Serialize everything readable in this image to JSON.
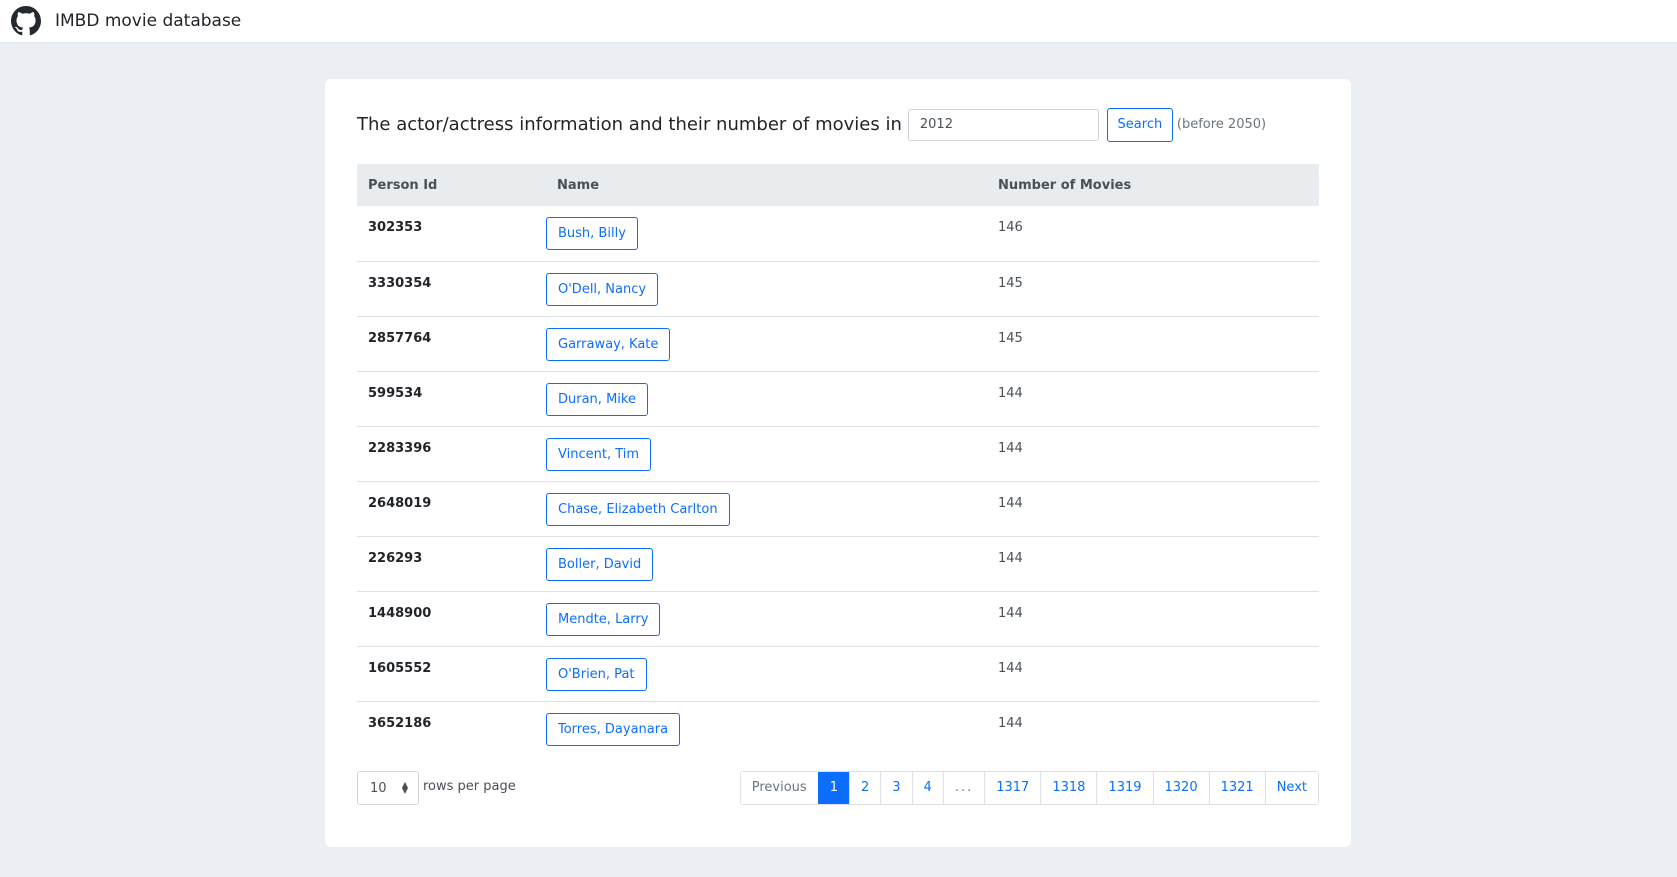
{
  "navbar": {
    "icon": "github-icon",
    "brand": "IMBD movie database"
  },
  "search": {
    "title": "The actor/actress information and their number of movies in",
    "value": "2012",
    "button_label": "Search",
    "hint": "(before 2050)"
  },
  "table": {
    "headers": [
      "Person Id",
      "Name",
      "Number of Movies"
    ],
    "rows": [
      {
        "id": "302353",
        "name": "Bush, Billy",
        "movies": "146"
      },
      {
        "id": "3330354",
        "name": "O'Dell, Nancy",
        "movies": "145"
      },
      {
        "id": "2857764",
        "name": "Garraway, Kate",
        "movies": "145"
      },
      {
        "id": "599534",
        "name": "Duran, Mike",
        "movies": "144"
      },
      {
        "id": "2283396",
        "name": "Vincent, Tim",
        "movies": "144"
      },
      {
        "id": "2648019",
        "name": "Chase, Elizabeth Carlton",
        "movies": "144"
      },
      {
        "id": "226293",
        "name": "Boller, David",
        "movies": "144"
      },
      {
        "id": "1448900",
        "name": "Mendte, Larry",
        "movies": "144"
      },
      {
        "id": "1605552",
        "name": "O'Brien, Pat",
        "movies": "144"
      },
      {
        "id": "3652186",
        "name": "Torres, Dayanara",
        "movies": "144"
      }
    ]
  },
  "footer": {
    "rows_per_page_value": "10",
    "rows_per_page_label": "rows per page",
    "pagination": {
      "previous": "Previous",
      "pages": [
        "1",
        "2",
        "3",
        "4",
        "...",
        "1317",
        "1318",
        "1319",
        "1320",
        "1321"
      ],
      "active": "1",
      "next": "Next"
    }
  },
  "colors": {
    "accent": "#0d6efd",
    "background": "#ebeef3",
    "header_bg": "#e9ecef"
  }
}
